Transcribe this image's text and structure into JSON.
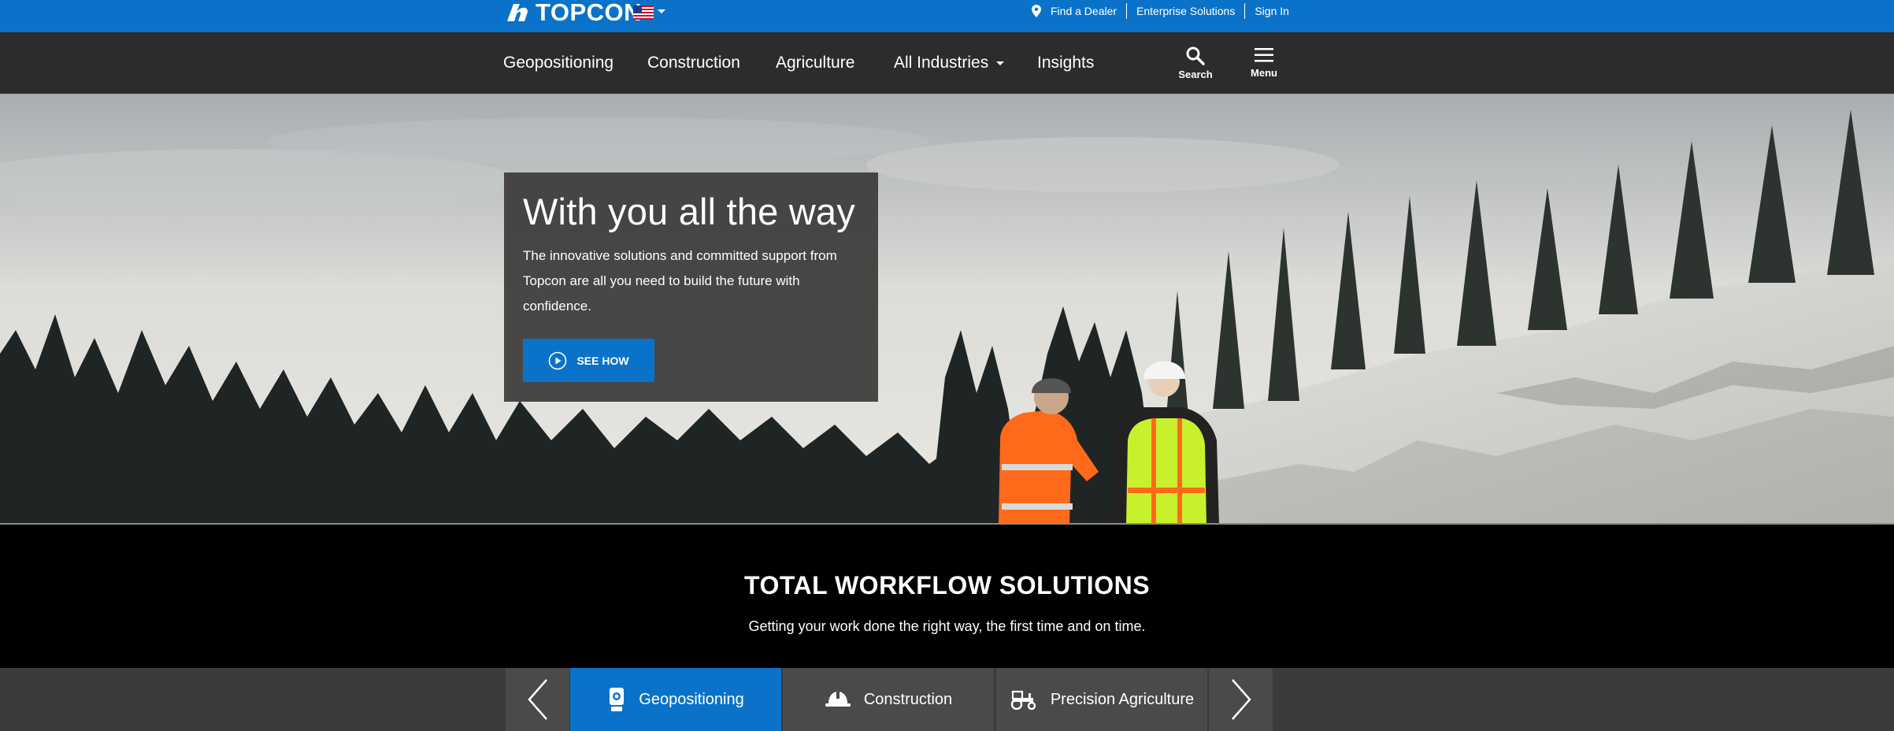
{
  "brand": {
    "name": "TOPCON",
    "accent": "#0a73c9",
    "nav_bg": "#2c2c2c"
  },
  "utility": {
    "region_flag": "us-flag-icon",
    "links": [
      "Find a Dealer",
      "Enterprise Solutions",
      "Sign In"
    ]
  },
  "nav": {
    "items": [
      "Geopositioning",
      "Construction",
      "Agriculture",
      "All Industries",
      "Insights"
    ],
    "search_label": "Search",
    "menu_label": "Menu"
  },
  "hero": {
    "title": "With you all the way",
    "text": "The innovative solutions and committed support from Topcon are all you need to build the future with confidence.",
    "cta": "SEE HOW"
  },
  "solutions": {
    "title": "TOTAL WORKFLOW SOLUTIONS",
    "subtitle": "Getting your work done the right way, the first time and on time."
  },
  "tabs": {
    "items": [
      "Geopositioning",
      "Construction",
      "Precision Agriculture"
    ],
    "active": "Geopositioning"
  }
}
